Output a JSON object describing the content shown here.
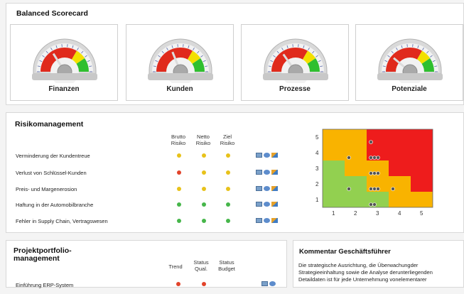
{
  "scorecard": {
    "title": "Balanced Scorecard",
    "gauges": [
      {
        "label": "Finanzen",
        "value_deg": 58
      },
      {
        "label": "Kunden",
        "value_deg": 68
      },
      {
        "label": "Prozesse",
        "value_deg": 55
      },
      {
        "label": "Potenziale",
        "value_deg": 40
      }
    ],
    "colors": {
      "red": "#e02a1c",
      "yellow": "#f3e000",
      "green": "#2fbf2f"
    }
  },
  "risk": {
    "title": "Risikomanagement",
    "columns": [
      "Brutto Risiko",
      "Netto Risiko",
      "Ziel Risiko"
    ],
    "rows": [
      {
        "label": "Verminderung der Kundentreue",
        "status": [
          "y",
          "y",
          "y"
        ]
      },
      {
        "label": "Verlust von Schlüssel-Kunden",
        "status": [
          "r",
          "y",
          "y"
        ]
      },
      {
        "label": "Preis- und Margenerosion",
        "status": [
          "y",
          "y",
          "y"
        ]
      },
      {
        "label": "Haftung in der Automobilbranche",
        "status": [
          "g",
          "g",
          "g"
        ]
      },
      {
        "label": "Fehler in Supply Chain, Vertragswesen",
        "status": [
          "g",
          "g",
          "g"
        ]
      }
    ],
    "action_icons": [
      "report-icon",
      "globe-icon",
      "chart-icon"
    ],
    "matrix": {
      "y_labels": [
        "5",
        "4",
        "3",
        "2",
        "1"
      ],
      "x_labels": [
        "1",
        "2",
        "3",
        "4",
        "5"
      ],
      "cells": [
        [
          "o",
          "o",
          "r",
          "r",
          "r"
        ],
        [
          "o",
          "o",
          "r",
          "r",
          "r"
        ],
        [
          "g",
          "o",
          "o",
          "r",
          "r"
        ],
        [
          "g",
          "g",
          "o",
          "o",
          "r"
        ],
        [
          "g",
          "g",
          "g",
          "o",
          "o"
        ]
      ],
      "colors": {
        "r": "#ee1c1c",
        "o": "#f9b300",
        "g": "#92d050"
      }
    }
  },
  "portfolio": {
    "title_line1": "Projektportfolio-",
    "title_line2": "management",
    "columns": [
      "Trend",
      "Status Qual.",
      "Status Budget"
    ],
    "first_row": "Einführung ERP-System"
  },
  "comment": {
    "title": "Kommentar Geschäftsführer",
    "lines": [
      "Die strategische Ausrichtung, die Überwachungder",
      "Strategieeinhaltung sowie die Analyse derunterliegenden",
      "Detaildaten ist für jede Unternehmung vonelementarer"
    ]
  }
}
